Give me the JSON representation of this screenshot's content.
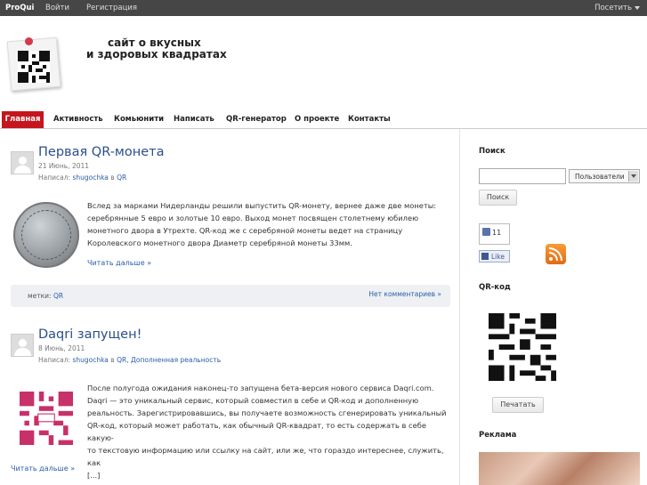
{
  "adminbar": {
    "brand": "ProQui",
    "login": "Войти",
    "register": "Регистрация",
    "visit": "Посетить"
  },
  "header": {
    "tagline_line1": "сайт о вкусных",
    "tagline_line2": "и здоровых квадратах"
  },
  "nav": {
    "items": [
      "Главная",
      "Активность",
      "Комьюнити",
      "Написать",
      "QR-генератор",
      "О проекте",
      "Контакты"
    ],
    "active": "Главная"
  },
  "posts": [
    {
      "title": "Первая QR-монета",
      "date": "21 Июнь, 2011",
      "author_prefix": "Написал:",
      "author": "shugochka",
      "in_word": "в",
      "categories": "QR",
      "text": [
        "Вслед за марками Нидерланды решили выпустить QR-монету, вернее даже две монеты:",
        "серебрянные 5 евро и золотые 10 евро. Выход монет посвящен столетнему юбилею",
        "монетного двора в Утрехте. QR-код же с серебряной монеты ведет на страницу",
        "Королевского монетного двора Диаметр серебряной монеты 33мм."
      ],
      "read_more": "Читать дальше »",
      "tags_label": "метки:",
      "tags": "QR",
      "comments": "Нет комментариев »"
    },
    {
      "title": "Daqri запущен!",
      "date": "8 Июнь, 2011",
      "author_prefix": "Написал:",
      "author": "shugochka",
      "in_word": "в",
      "categories": "QR, Дополненная реальность",
      "text": [
        "После полугода ожидания наконец-то запущена бета-версия нового сервиса Daqri.com.",
        "Daqri — это уникальный сервис, который совместил в себе и QR-код и дополненную",
        "реальность. Зарегистрировавшись, вы получаете возможность сгенерировать уникальный",
        "QR-код, который может работать, как обычный QR-квадрат, то есть содержать в себе какую-",
        "то текстовую информацию или ссылку на сайт, или же, что гораздо интереснее, служить, как",
        "[...]"
      ],
      "read_more": "Читать дальше »"
    }
  ],
  "sidebar": {
    "search_title": "Поиск",
    "search_placeholder": "",
    "search_scope": "Пользователи",
    "search_button": "Поиск",
    "fb_count": "11",
    "fb_like": "Like",
    "qr_title": "QR-код",
    "print_button": "Печатать",
    "ads_title": "Реклама"
  },
  "colors": {
    "accent": "#c4161c",
    "link": "#2a5ea8",
    "title": "#2a4f8a",
    "adminbar": "#464646"
  }
}
